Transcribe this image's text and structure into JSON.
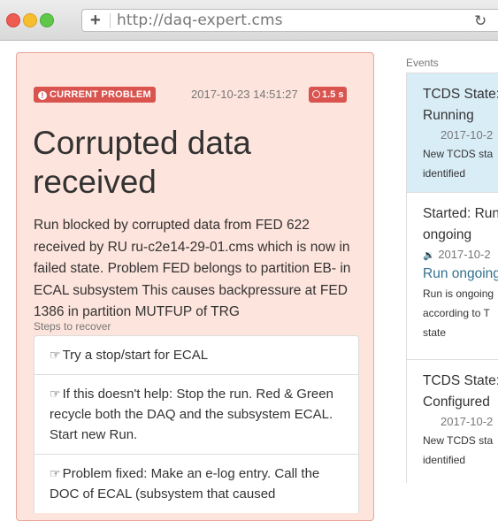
{
  "browser": {
    "url": "http://daq-expert.cms"
  },
  "problem": {
    "badge": "CURRENT PROBLEM",
    "timestamp": "2017-10-23 14:51:27",
    "duration": "1.5 s",
    "title": "Corrupted data received",
    "description": "Run blocked by corrupted data from FED 622 received by RU ru-c2e14-29-01.cms which is now in failed state. Problem FED belongs to partition EB- in ECAL subsystem This causes backpressure at FED 1386 in partition MUTFUP of TRG",
    "steps_label": "Steps to recover",
    "steps": [
      {
        "text": "Try a stop/start for ECAL"
      },
      {
        "text": "If this doesn't help: Stop the run. Red & Green recycle both the DAQ and the subsystem ECAL. Start new Run."
      },
      {
        "text": "Problem fixed: Make an e-log entry. Call the DOC of ECAL (subsystem that caused"
      }
    ]
  },
  "events": {
    "label": "Events",
    "items": [
      {
        "title": "TCDS State: Running",
        "time": "2017-10-2",
        "description": "New TCDS sta",
        "description2": "identified"
      },
      {
        "title": "Started: Run ongoing",
        "time": "2017-10-2",
        "subtitle": "Run ongoing",
        "description": "Run is ongoing",
        "description2": "according to T",
        "description3": "state"
      },
      {
        "title": "TCDS State: Configured",
        "time": "2017-10-2",
        "description": "New TCDS sta",
        "description2": "identified"
      }
    ]
  }
}
